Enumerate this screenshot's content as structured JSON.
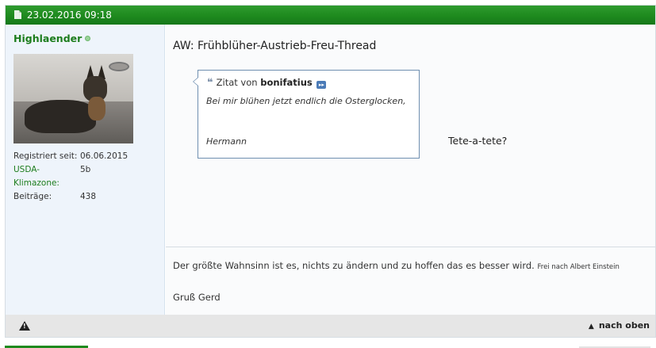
{
  "header": {
    "timestamp": "23.02.2016 09:18"
  },
  "user": {
    "name": "Highlaender",
    "stats": [
      {
        "label": "Registriert seit:",
        "value": "06.06.2015",
        "highlight": false
      },
      {
        "label": "USDA-Klimazone:",
        "value": "5b",
        "highlight": true
      },
      {
        "label": "Beiträge:",
        "value": "438",
        "highlight": false
      }
    ]
  },
  "post": {
    "title": "AW: Frühblüher-Austrieb-Freu-Thread",
    "quote": {
      "prefix": "Zitat von",
      "author": "bonifatius",
      "text": "Bei mir blühen jetzt endlich die Osterglocken,",
      "signature": "Hermann"
    },
    "reply": "Tete-a-tete?"
  },
  "signature": {
    "line1": "Der größte Wahnsinn ist es, nichts zu ändern und zu hoffen das es besser wird.",
    "line1_small": "Frei nach Albert Einstein",
    "line2": "Gruß Gerd"
  },
  "footer": {
    "top_link": "nach oben"
  },
  "colors": {
    "header_green": "#1e8a1e",
    "sidebar_bg": "#eef4fb",
    "username_green": "#1d7d1d",
    "quote_border": "#6f8fb0"
  }
}
